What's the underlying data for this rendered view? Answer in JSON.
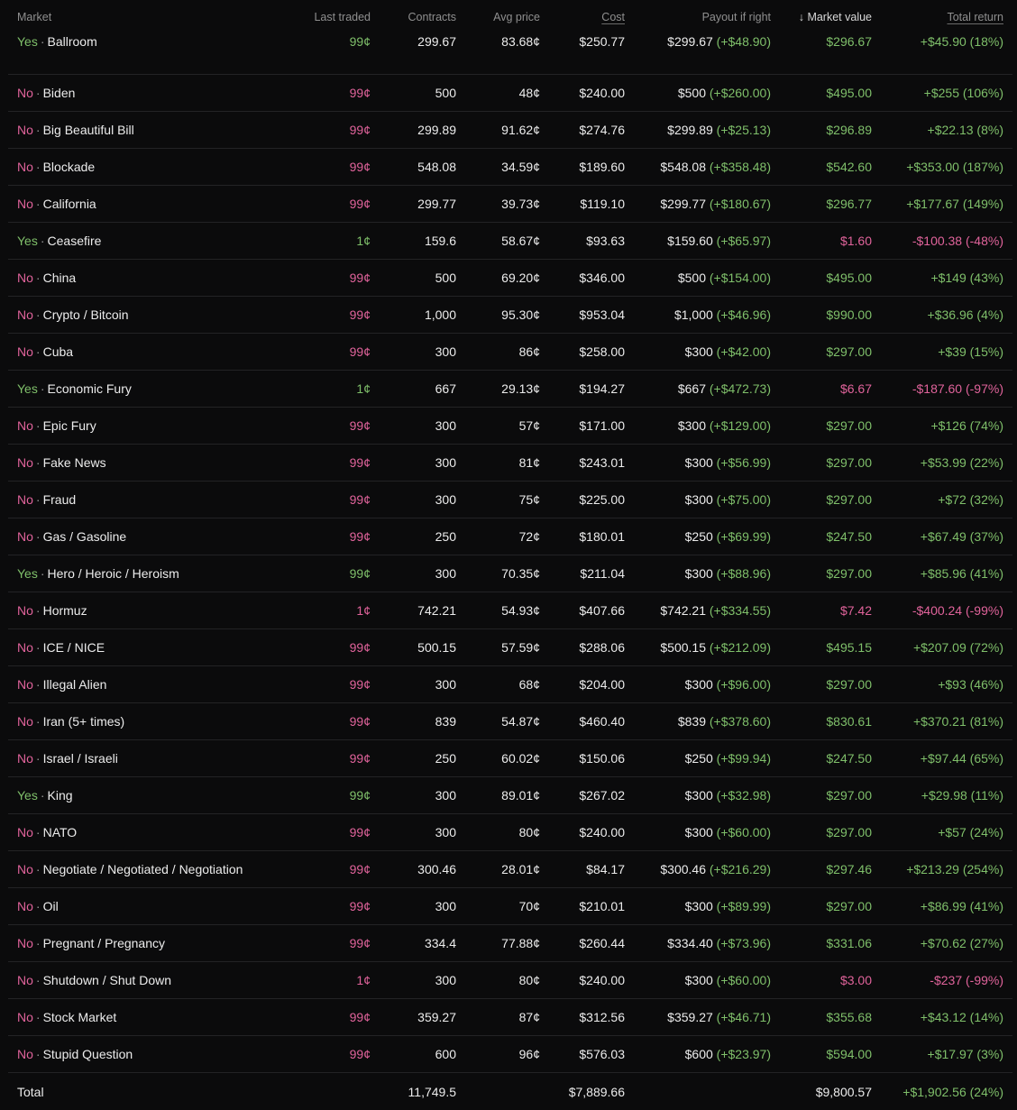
{
  "headers": {
    "market": "Market",
    "last_traded": "Last traded",
    "contracts": "Contracts",
    "avg_price": "Avg price",
    "cost": "Cost",
    "payout": "Payout if right",
    "market_value": "Market value",
    "total_return": "Total return",
    "sort_arrow": "↓"
  },
  "rows": [
    {
      "side": "Yes",
      "name": "Ballroom",
      "last": "99¢",
      "contracts": "299.67",
      "avg": "83.68¢",
      "cost": "$250.77",
      "payout": "$299.67",
      "payout_gain": "(+$48.90)",
      "value": "$296.67",
      "ret": "+$45.90 (18%)",
      "up": true
    },
    {
      "side": "No",
      "name": "Biden",
      "last": "99¢",
      "contracts": "500",
      "avg": "48¢",
      "cost": "$240.00",
      "payout": "$500",
      "payout_gain": "(+$260.00)",
      "value": "$495.00",
      "ret": "+$255 (106%)",
      "up": true
    },
    {
      "side": "No",
      "name": "Big Beautiful Bill",
      "last": "99¢",
      "contracts": "299.89",
      "avg": "91.62¢",
      "cost": "$274.76",
      "payout": "$299.89",
      "payout_gain": "(+$25.13)",
      "value": "$296.89",
      "ret": "+$22.13 (8%)",
      "up": true
    },
    {
      "side": "No",
      "name": "Blockade",
      "last": "99¢",
      "contracts": "548.08",
      "avg": "34.59¢",
      "cost": "$189.60",
      "payout": "$548.08",
      "payout_gain": "(+$358.48)",
      "value": "$542.60",
      "ret": "+$353.00 (187%)",
      "up": true
    },
    {
      "side": "No",
      "name": "California",
      "last": "99¢",
      "contracts": "299.77",
      "avg": "39.73¢",
      "cost": "$119.10",
      "payout": "$299.77",
      "payout_gain": "(+$180.67)",
      "value": "$296.77",
      "ret": "+$177.67 (149%)",
      "up": true
    },
    {
      "side": "Yes",
      "name": "Ceasefire",
      "last": "1¢",
      "contracts": "159.6",
      "avg": "58.67¢",
      "cost": "$93.63",
      "payout": "$159.60",
      "payout_gain": "(+$65.97)",
      "value": "$1.60",
      "ret": "-$100.38 (-48%)",
      "up": false
    },
    {
      "side": "No",
      "name": "China",
      "last": "99¢",
      "contracts": "500",
      "avg": "69.20¢",
      "cost": "$346.00",
      "payout": "$500",
      "payout_gain": "(+$154.00)",
      "value": "$495.00",
      "ret": "+$149 (43%)",
      "up": true
    },
    {
      "side": "No",
      "name": "Crypto / Bitcoin",
      "last": "99¢",
      "contracts": "1,000",
      "avg": "95.30¢",
      "cost": "$953.04",
      "payout": "$1,000",
      "payout_gain": "(+$46.96)",
      "value": "$990.00",
      "ret": "+$36.96 (4%)",
      "up": true
    },
    {
      "side": "No",
      "name": "Cuba",
      "last": "99¢",
      "contracts": "300",
      "avg": "86¢",
      "cost": "$258.00",
      "payout": "$300",
      "payout_gain": "(+$42.00)",
      "value": "$297.00",
      "ret": "+$39 (15%)",
      "up": true
    },
    {
      "side": "Yes",
      "name": "Economic Fury",
      "last": "1¢",
      "contracts": "667",
      "avg": "29.13¢",
      "cost": "$194.27",
      "payout": "$667",
      "payout_gain": "(+$472.73)",
      "value": "$6.67",
      "ret": "-$187.60 (-97%)",
      "up": false
    },
    {
      "side": "No",
      "name": "Epic Fury",
      "last": "99¢",
      "contracts": "300",
      "avg": "57¢",
      "cost": "$171.00",
      "payout": "$300",
      "payout_gain": "(+$129.00)",
      "value": "$297.00",
      "ret": "+$126 (74%)",
      "up": true
    },
    {
      "side": "No",
      "name": "Fake News",
      "last": "99¢",
      "contracts": "300",
      "avg": "81¢",
      "cost": "$243.01",
      "payout": "$300",
      "payout_gain": "(+$56.99)",
      "value": "$297.00",
      "ret": "+$53.99 (22%)",
      "up": true
    },
    {
      "side": "No",
      "name": "Fraud",
      "last": "99¢",
      "contracts": "300",
      "avg": "75¢",
      "cost": "$225.00",
      "payout": "$300",
      "payout_gain": "(+$75.00)",
      "value": "$297.00",
      "ret": "+$72 (32%)",
      "up": true
    },
    {
      "side": "No",
      "name": "Gas / Gasoline",
      "last": "99¢",
      "contracts": "250",
      "avg": "72¢",
      "cost": "$180.01",
      "payout": "$250",
      "payout_gain": "(+$69.99)",
      "value": "$247.50",
      "ret": "+$67.49 (37%)",
      "up": true
    },
    {
      "side": "Yes",
      "name": "Hero / Heroic / Heroism",
      "last": "99¢",
      "contracts": "300",
      "avg": "70.35¢",
      "cost": "$211.04",
      "payout": "$300",
      "payout_gain": "(+$88.96)",
      "value": "$297.00",
      "ret": "+$85.96 (41%)",
      "up": true
    },
    {
      "side": "No",
      "name": "Hormuz",
      "last": "1¢",
      "contracts": "742.21",
      "avg": "54.93¢",
      "cost": "$407.66",
      "payout": "$742.21",
      "payout_gain": "(+$334.55)",
      "value": "$7.42",
      "ret": "-$400.24 (-99%)",
      "up": false
    },
    {
      "side": "No",
      "name": "ICE / NICE",
      "last": "99¢",
      "contracts": "500.15",
      "avg": "57.59¢",
      "cost": "$288.06",
      "payout": "$500.15",
      "payout_gain": "(+$212.09)",
      "value": "$495.15",
      "ret": "+$207.09 (72%)",
      "up": true
    },
    {
      "side": "No",
      "name": "Illegal Alien",
      "last": "99¢",
      "contracts": "300",
      "avg": "68¢",
      "cost": "$204.00",
      "payout": "$300",
      "payout_gain": "(+$96.00)",
      "value": "$297.00",
      "ret": "+$93 (46%)",
      "up": true
    },
    {
      "side": "No",
      "name": "Iran (5+ times)",
      "last": "99¢",
      "contracts": "839",
      "avg": "54.87¢",
      "cost": "$460.40",
      "payout": "$839",
      "payout_gain": "(+$378.60)",
      "value": "$830.61",
      "ret": "+$370.21 (81%)",
      "up": true
    },
    {
      "side": "No",
      "name": "Israel / Israeli",
      "last": "99¢",
      "contracts": "250",
      "avg": "60.02¢",
      "cost": "$150.06",
      "payout": "$250",
      "payout_gain": "(+$99.94)",
      "value": "$247.50",
      "ret": "+$97.44 (65%)",
      "up": true
    },
    {
      "side": "Yes",
      "name": "King",
      "last": "99¢",
      "contracts": "300",
      "avg": "89.01¢",
      "cost": "$267.02",
      "payout": "$300",
      "payout_gain": "(+$32.98)",
      "value": "$297.00",
      "ret": "+$29.98 (11%)",
      "up": true
    },
    {
      "side": "No",
      "name": "NATO",
      "last": "99¢",
      "contracts": "300",
      "avg": "80¢",
      "cost": "$240.00",
      "payout": "$300",
      "payout_gain": "(+$60.00)",
      "value": "$297.00",
      "ret": "+$57 (24%)",
      "up": true
    },
    {
      "side": "No",
      "name": "Negotiate / Negotiated / Negotiation",
      "last": "99¢",
      "contracts": "300.46",
      "avg": "28.01¢",
      "cost": "$84.17",
      "payout": "$300.46",
      "payout_gain": "(+$216.29)",
      "value": "$297.46",
      "ret": "+$213.29 (254%)",
      "up": true
    },
    {
      "side": "No",
      "name": "Oil",
      "last": "99¢",
      "contracts": "300",
      "avg": "70¢",
      "cost": "$210.01",
      "payout": "$300",
      "payout_gain": "(+$89.99)",
      "value": "$297.00",
      "ret": "+$86.99 (41%)",
      "up": true
    },
    {
      "side": "No",
      "name": "Pregnant / Pregnancy",
      "last": "99¢",
      "contracts": "334.4",
      "avg": "77.88¢",
      "cost": "$260.44",
      "payout": "$334.40",
      "payout_gain": "(+$73.96)",
      "value": "$331.06",
      "ret": "+$70.62 (27%)",
      "up": true
    },
    {
      "side": "No",
      "name": "Shutdown / Shut Down",
      "last": "1¢",
      "contracts": "300",
      "avg": "80¢",
      "cost": "$240.00",
      "payout": "$300",
      "payout_gain": "(+$60.00)",
      "value": "$3.00",
      "ret": "-$237 (-99%)",
      "up": false
    },
    {
      "side": "No",
      "name": "Stock Market",
      "last": "99¢",
      "contracts": "359.27",
      "avg": "87¢",
      "cost": "$312.56",
      "payout": "$359.27",
      "payout_gain": "(+$46.71)",
      "value": "$355.68",
      "ret": "+$43.12 (14%)",
      "up": true
    },
    {
      "side": "No",
      "name": "Stupid Question",
      "last": "99¢",
      "contracts": "600",
      "avg": "96¢",
      "cost": "$576.03",
      "payout": "$600",
      "payout_gain": "(+$23.97)",
      "value": "$594.00",
      "ret": "+$17.97 (3%)",
      "up": true
    }
  ],
  "total": {
    "label": "Total",
    "contracts": "11,749.5",
    "cost": "$7,889.66",
    "value": "$9,800.57",
    "ret": "+$1,902.56 (24%)"
  },
  "colors": {
    "background": "#0b0b0c",
    "yes": "#7fbf6a",
    "no": "#e0639b",
    "positive": "#7fbf6a",
    "negative": "#e0639b"
  }
}
